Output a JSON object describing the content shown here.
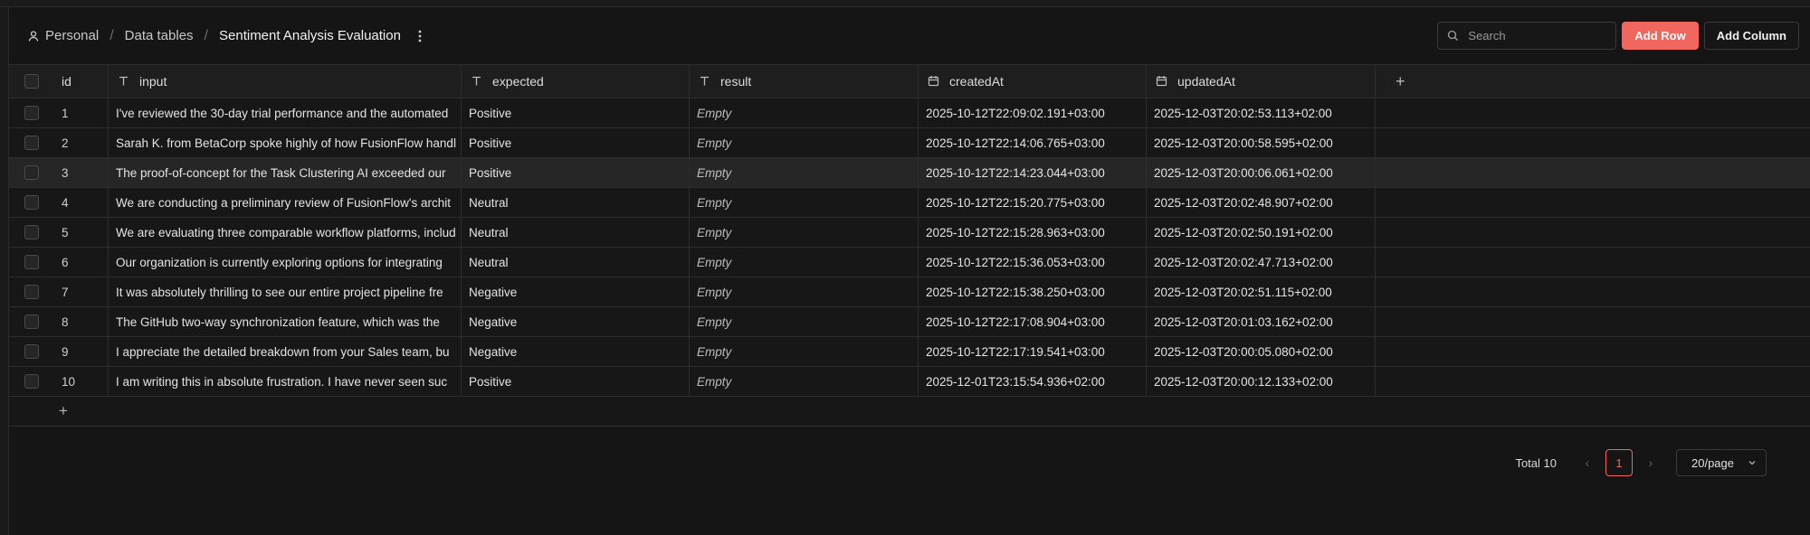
{
  "breadcrumb": {
    "root": "Personal",
    "section": "Data tables",
    "current": "Sentiment Analysis Evaluation"
  },
  "search": {
    "placeholder": "Search"
  },
  "toolbar": {
    "add_row": "Add Row",
    "add_column": "Add Column"
  },
  "colors": {
    "accent": "#f0675f",
    "background": "#151515"
  },
  "columns": [
    {
      "key": "id",
      "label": "id",
      "icon": ""
    },
    {
      "key": "input",
      "label": "input",
      "icon": "text-type-icon"
    },
    {
      "key": "expected",
      "label": "expected",
      "icon": "text-type-icon"
    },
    {
      "key": "result",
      "label": "result",
      "icon": "text-type-icon"
    },
    {
      "key": "createdAt",
      "label": "createdAt",
      "icon": "calendar-icon"
    },
    {
      "key": "updatedAt",
      "label": "updatedAt",
      "icon": "calendar-icon"
    }
  ],
  "rows": [
    {
      "id": "1",
      "input": "I've reviewed the 30-day trial performance and the automated",
      "expected": "Positive",
      "result": "Empty",
      "createdAt": "2025-10-12T22:09:02.191+03:00",
      "updatedAt": "2025-12-03T20:02:53.113+02:00"
    },
    {
      "id": "2",
      "input": "Sarah K. from BetaCorp spoke highly of how FusionFlow handl",
      "expected": "Positive",
      "result": "Empty",
      "createdAt": "2025-10-12T22:14:06.765+03:00",
      "updatedAt": "2025-12-03T20:00:58.595+02:00"
    },
    {
      "id": "3",
      "input": "The proof-of-concept for the Task Clustering AI exceeded our",
      "expected": "Positive",
      "result": "Empty",
      "createdAt": "2025-10-12T22:14:23.044+03:00",
      "updatedAt": "2025-12-03T20:00:06.061+02:00"
    },
    {
      "id": "4",
      "input": "We are conducting a preliminary review of FusionFlow's archit",
      "expected": "Neutral",
      "result": "Empty",
      "createdAt": "2025-10-12T22:15:20.775+03:00",
      "updatedAt": "2025-12-03T20:02:48.907+02:00"
    },
    {
      "id": "5",
      "input": "We are evaluating three comparable workflow platforms, includ",
      "expected": "Neutral",
      "result": "Empty",
      "createdAt": "2025-10-12T22:15:28.963+03:00",
      "updatedAt": "2025-12-03T20:02:50.191+02:00"
    },
    {
      "id": "6",
      "input": "Our organization is currently exploring options for integrating",
      "expected": "Neutral",
      "result": "Empty",
      "createdAt": "2025-10-12T22:15:36.053+03:00",
      "updatedAt": "2025-12-03T20:02:47.713+02:00"
    },
    {
      "id": "7",
      "input": "It was absolutely thrilling to see our entire project pipeline fre",
      "expected": "Negative",
      "result": "Empty",
      "createdAt": "2025-10-12T22:15:38.250+03:00",
      "updatedAt": "2025-12-03T20:02:51.115+02:00"
    },
    {
      "id": "8",
      "input": "The GitHub two-way synchronization feature, which was the",
      "expected": "Negative",
      "result": "Empty",
      "createdAt": "2025-10-12T22:17:08.904+03:00",
      "updatedAt": "2025-12-03T20:01:03.162+02:00"
    },
    {
      "id": "9",
      "input": "I appreciate the detailed breakdown from your Sales team, bu",
      "expected": "Negative",
      "result": "Empty",
      "createdAt": "2025-10-12T22:17:19.541+03:00",
      "updatedAt": "2025-12-03T20:00:05.080+02:00"
    },
    {
      "id": "10",
      "input": "I am writing this in absolute frustration. I have never seen suc",
      "expected": "Positive",
      "result": "Empty",
      "createdAt": "2025-12-01T23:15:54.936+02:00",
      "updatedAt": "2025-12-03T20:00:12.133+02:00"
    }
  ],
  "hovered_row_index": 2,
  "pagination": {
    "total_label": "Total 10",
    "current_page": "1",
    "page_size": "20/page"
  }
}
